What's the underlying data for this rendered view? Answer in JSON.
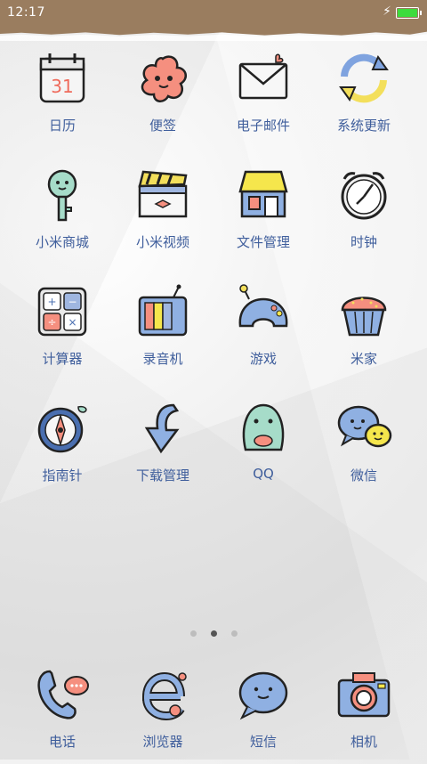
{
  "status_bar": {
    "time": "12:17",
    "battery_level": 1.0,
    "charging": true
  },
  "apps": [
    {
      "label": "日历",
      "icon": "calendar-icon"
    },
    {
      "label": "便签",
      "icon": "note-flower-icon"
    },
    {
      "label": "电子邮件",
      "icon": "mail-icon"
    },
    {
      "label": "系统更新",
      "icon": "refresh-icon"
    },
    {
      "label": "小米商城",
      "icon": "key-shop-icon"
    },
    {
      "label": "小米视频",
      "icon": "clapperboard-icon"
    },
    {
      "label": "文件管理",
      "icon": "store-icon"
    },
    {
      "label": "时钟",
      "icon": "alarm-clock-icon"
    },
    {
      "label": "计算器",
      "icon": "calculator-icon"
    },
    {
      "label": "录音机",
      "icon": "tv-recorder-icon"
    },
    {
      "label": "游戏",
      "icon": "gamepad-icon"
    },
    {
      "label": "米家",
      "icon": "cupcake-icon"
    },
    {
      "label": "指南针",
      "icon": "compass-icon"
    },
    {
      "label": "下载管理",
      "icon": "download-arrow-icon"
    },
    {
      "label": "QQ",
      "icon": "qq-penguin-icon"
    },
    {
      "label": "微信",
      "icon": "wechat-bubbles-icon"
    }
  ],
  "calendar_day": "31",
  "page_indicator": {
    "pages": 3,
    "current": 2
  },
  "dock": [
    {
      "label": "电话",
      "icon": "phone-icon"
    },
    {
      "label": "浏览器",
      "icon": "browser-icon"
    },
    {
      "label": "短信",
      "icon": "message-icon"
    },
    {
      "label": "相机",
      "icon": "camera-icon"
    }
  ],
  "colors": {
    "label": "#3f5e9c",
    "status_bar": "#9a7d5f",
    "battery": "#3ddc3d"
  }
}
